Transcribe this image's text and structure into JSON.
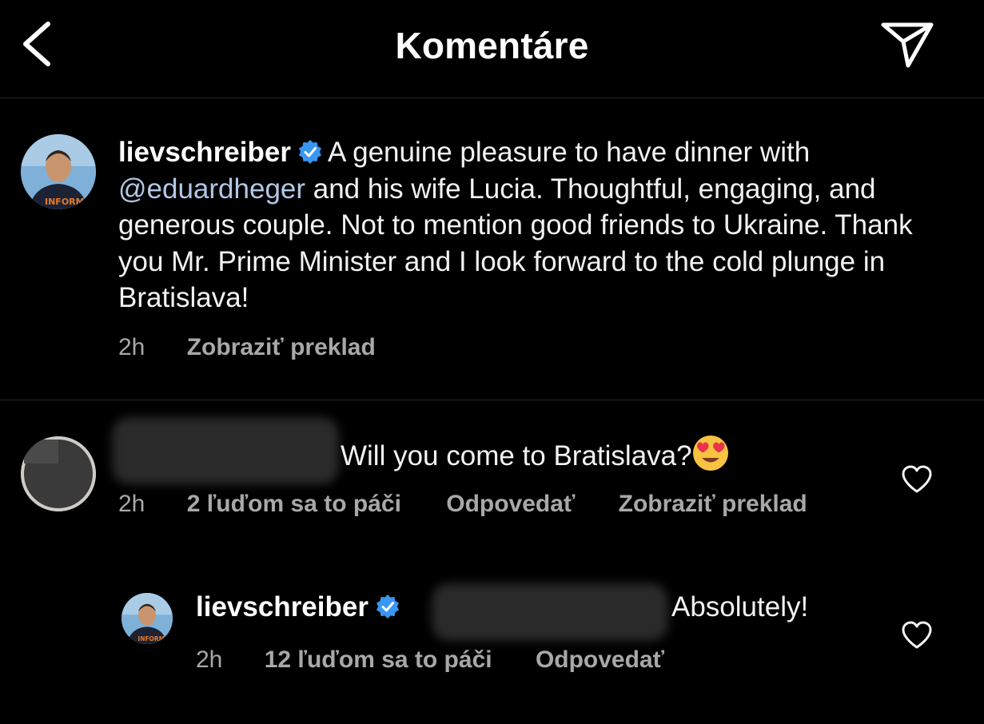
{
  "header": {
    "title": "Komentáre",
    "back_icon": "chevron-left-icon",
    "share_icon": "send-icon"
  },
  "caption": {
    "username": "lievschreiber",
    "text_before_mention": "A genuine pleasure to have dinner with ",
    "mention": "@eduardheger",
    "text_after_mention": " and his wife Lucia. Thoughtful, engaging, and generous couple. Not to mention good friends to Ukraine. Thank you Mr. Prime Minister and I look forward to the cold plunge in Bratislava!",
    "time": "2h",
    "translate": "Zobraziť preklad"
  },
  "comment": {
    "text": "Will you come to Bratislava?",
    "emoji": "heart-eyes-emoji",
    "time": "2h",
    "likes": "2 ľuďom sa to páči",
    "reply": "Odpovedať",
    "translate": "Zobraziť preklad"
  },
  "reply": {
    "username": "lievschreiber",
    "text": "Absolutely!",
    "time": "2h",
    "likes": "12 ľuďom sa to páči",
    "reply": "Odpovedať"
  },
  "colors": {
    "background": "#000000",
    "text": "#f5f5f5",
    "muted": "#a8a8a8",
    "mention": "#b3c7e6",
    "verified": "#3897f0"
  }
}
